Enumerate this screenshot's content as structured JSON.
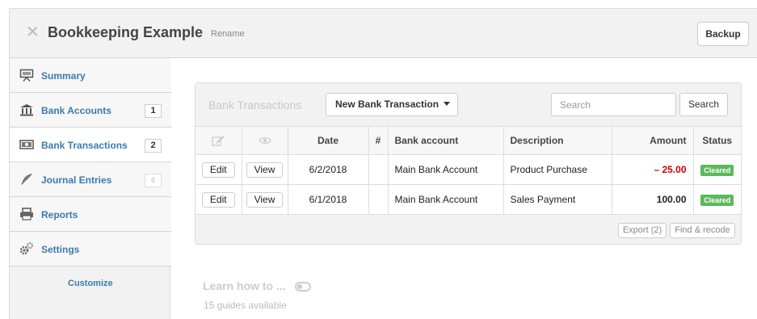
{
  "header": {
    "business_name": "Bookkeeping Example",
    "rename_label": "Rename",
    "backup_label": "Backup",
    "close_icon": "close-icon"
  },
  "sidebar": {
    "items": [
      {
        "label": "Summary",
        "icon": "presentation-icon",
        "count": ""
      },
      {
        "label": "Bank Accounts",
        "icon": "bank-icon",
        "count": "1"
      },
      {
        "label": "Bank Transactions",
        "icon": "money-icon",
        "count": "2"
      },
      {
        "label": "Journal Entries",
        "icon": "quill-icon",
        "count": "0"
      },
      {
        "label": "Reports",
        "icon": "printer-icon",
        "count": ""
      },
      {
        "label": "Settings",
        "icon": "gears-icon",
        "count": ""
      }
    ],
    "customize_label": "Customize"
  },
  "panel": {
    "title": "Bank Transactions",
    "new_button_label": "New Bank Transaction",
    "search_placeholder": "Search",
    "search_button_label": "Search",
    "columns": {
      "edit_icon": "edit-icon",
      "view_icon": "eye-icon",
      "date": "Date",
      "number": "#",
      "bank_account": "Bank account",
      "description": "Description",
      "amount": "Amount",
      "status": "Status"
    },
    "rows": [
      {
        "edit": "Edit",
        "view": "View",
        "date": "6/2/2018",
        "number": "",
        "bank_account": "Main Bank Account",
        "description": "Product Purchase",
        "amount": "– 25.00",
        "status": "Cleared"
      },
      {
        "edit": "Edit",
        "view": "View",
        "date": "6/1/2018",
        "number": "",
        "bank_account": "Main Bank Account",
        "description": "Sales Payment",
        "amount": "100.00",
        "status": "Cleared"
      }
    ],
    "export_label": "Export (2)",
    "find_recode_label": "Find & recode"
  },
  "guides": {
    "learn_label": "Learn how to ...",
    "available_label": "15 guides available"
  },
  "colors": {
    "link_blue": "#3a7ab0",
    "status_green": "#5cb85c",
    "negative_red": "#cc0000"
  }
}
